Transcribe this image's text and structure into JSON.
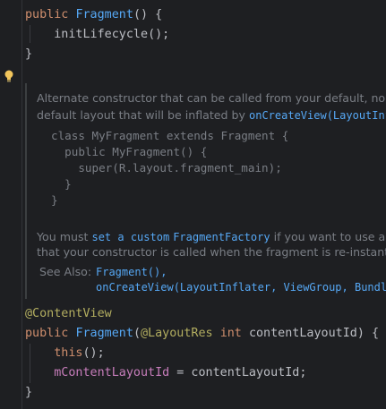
{
  "code": {
    "l1": {
      "kw": "public",
      "fn": "Fragment",
      "rest": "() {"
    },
    "l2": {
      "call": "initLifecycle",
      "rest": "();"
    },
    "l3": "}",
    "annotation": "@ContentView",
    "l4": {
      "kw": "public",
      "fn": "Fragment",
      "open": "(",
      "ann": "@LayoutRes",
      "type": "int",
      "param": "contentLayoutId",
      "rest": ") {"
    },
    "l5": {
      "kw": "this",
      "rest": "();"
    },
    "l6": {
      "field": "mContentLayoutId",
      "rest": " = contentLayoutId;"
    },
    "l7": "}"
  },
  "doc": {
    "p1_line1": "Alternate constructor that can be called from your default, no",
    "p1_line2_prefix": "default layout that will be inflated by ",
    "p1_line2_link": "onCreateView(LayoutInfl",
    "sample": [
      "class MyFragment extends Fragment {",
      "  public MyFragment() {",
      "    super(R.layout.fragment_main);",
      "  }",
      "}"
    ],
    "p2_line1_prefix": "You must ",
    "p2_line1_link1": "set a custom",
    "p2_line1_link2": "FragmentFactory",
    "p2_line1_suffix": " if you want to use a",
    "p2_line2": "that your constructor is called when the fragment is re-instant",
    "see_also_label": "See Also:",
    "see_also_1": "Fragment(),",
    "see_also_2": "onCreateView(LayoutInflater, ViewGroup, Bundle"
  },
  "icons": {
    "intention": "lightbulb-icon"
  },
  "colors": {
    "background": "#1e1f22",
    "keyword": "#cf8e6d",
    "function": "#56a8f5",
    "annotation": "#b3ae60",
    "field": "#c77dbb",
    "doc": "#7a7e85"
  }
}
